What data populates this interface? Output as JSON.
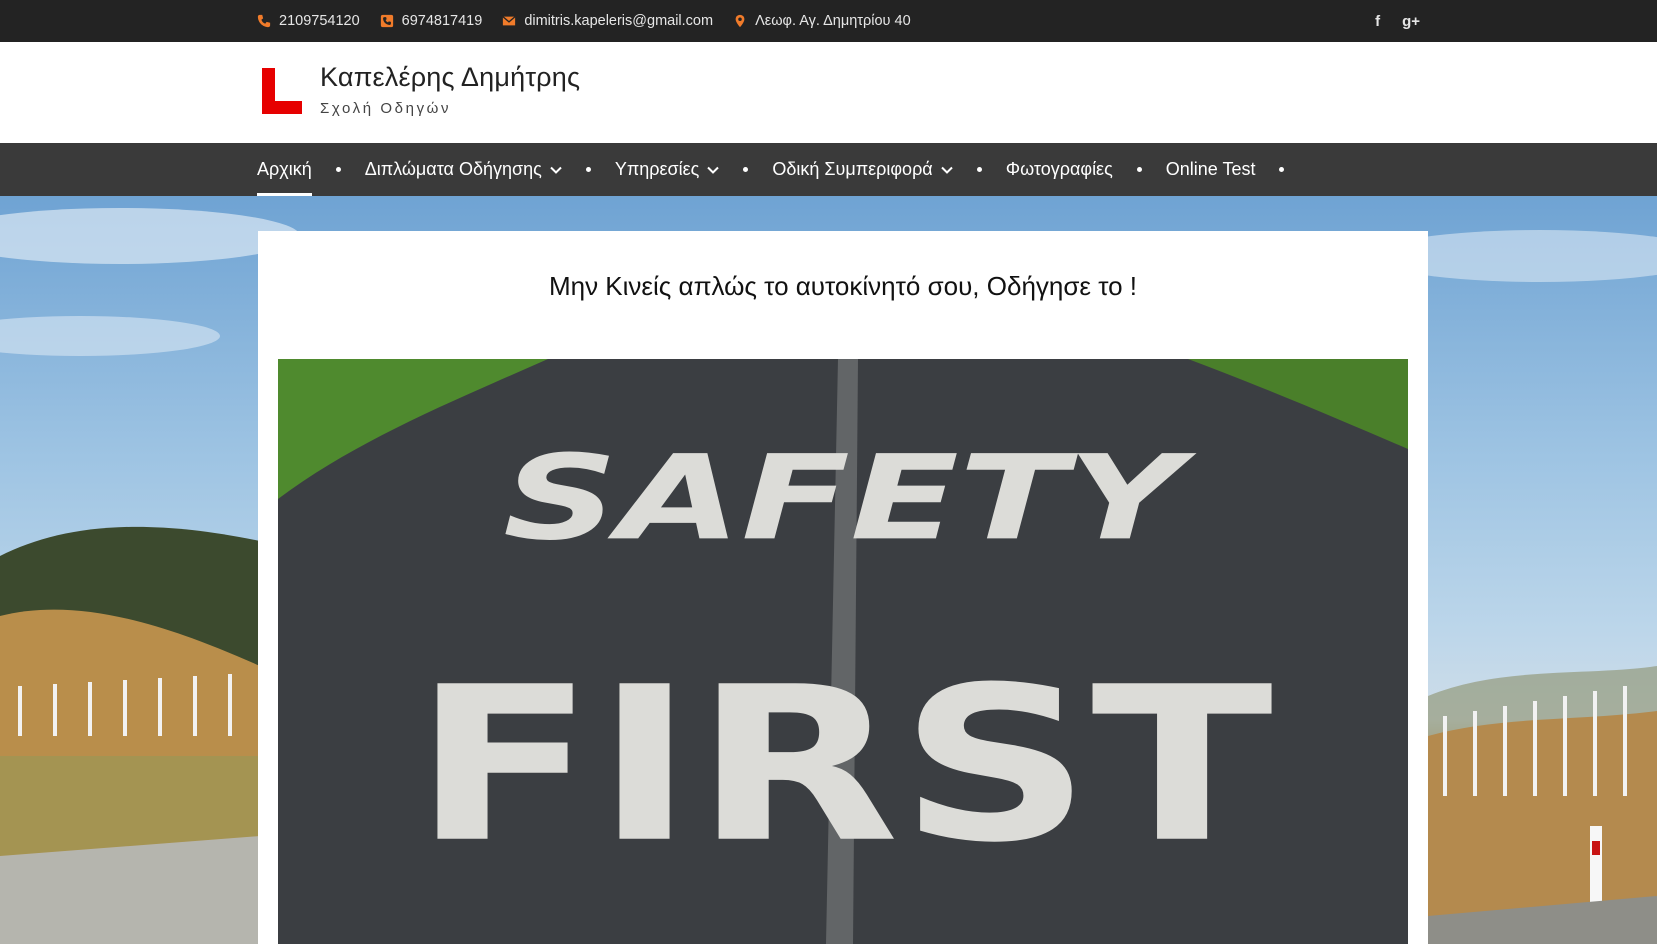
{
  "topbar": {
    "phone1": "2109754120",
    "phone2": "6974817419",
    "email": "dimitris.kapeleris@gmail.com",
    "address": "Λεωφ. Αγ. Δημητρίου 40",
    "social": {
      "facebook": "f",
      "google_plus": "g+"
    },
    "accent_color": "#f07b2a"
  },
  "header": {
    "title": "Καπελέρης Δημήτρης",
    "tagline": "Σχολή Οδηγών",
    "logo_color": "#e60000"
  },
  "nav": {
    "items": [
      {
        "label": "Αρχική",
        "active": true,
        "dropdown": false
      },
      {
        "label": "Διπλώματα Οδήγησης",
        "active": false,
        "dropdown": true
      },
      {
        "label": "Υπηρεσίες",
        "active": false,
        "dropdown": true
      },
      {
        "label": "Οδική Συμπεριφορά",
        "active": false,
        "dropdown": true
      },
      {
        "label": "Φωτογραφίες",
        "active": false,
        "dropdown": false
      },
      {
        "label": "Online Test",
        "active": false,
        "dropdown": false
      }
    ]
  },
  "main": {
    "headline": "Μην Κινείς απλώς το αυτοκίνητό σου, Οδήγησε το !",
    "featured_image": {
      "line1": "SAFETY",
      "line2": "FIRST"
    }
  }
}
